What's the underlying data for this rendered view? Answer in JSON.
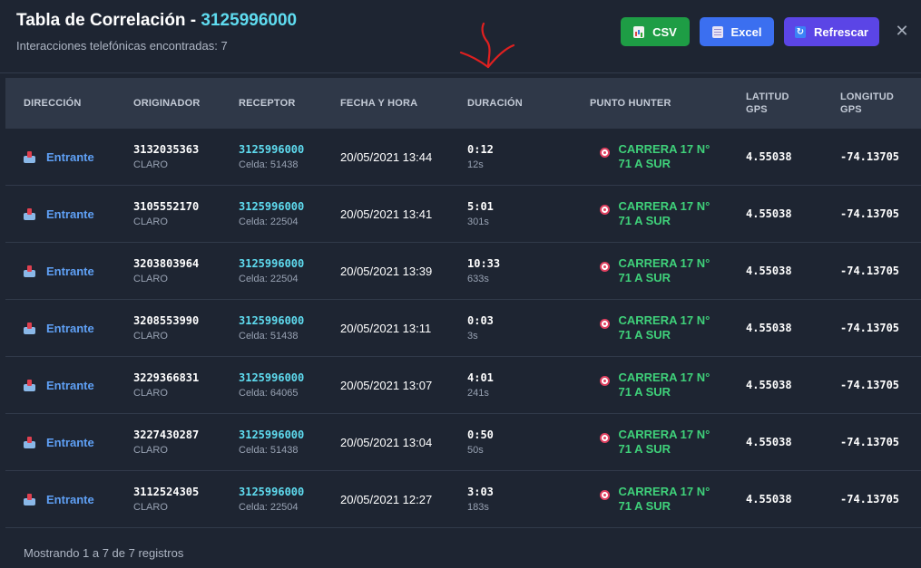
{
  "header": {
    "title": "Tabla de Correlación - ",
    "phone": "3125996000",
    "subtitle": "Interacciones telefónicas encontradas: 7",
    "buttons": {
      "csv": "CSV",
      "excel": "Excel",
      "refresh": "Refrescar"
    },
    "close": "✕"
  },
  "table": {
    "columns": [
      "DIRECCIÓN",
      "ORIGINADOR",
      "RECEPTOR",
      "FECHA Y HORA",
      "DURACIÓN",
      "PUNTO HUNTER",
      "LATITUD GPS",
      "LONGITUD GPS"
    ],
    "rows": [
      {
        "direction": "Entrante",
        "originator": "3132035363",
        "originator_carrier": "CLARO",
        "receiver": "3125996000",
        "receiver_cell": "Celda: 51438",
        "datetime": "20/05/2021 13:44",
        "duration": "0:12",
        "duration_seconds": "12s",
        "hunter": "CARRERA 17 N° 71 A SUR",
        "lat": "4.55038",
        "lon": "-74.13705"
      },
      {
        "direction": "Entrante",
        "originator": "3105552170",
        "originator_carrier": "CLARO",
        "receiver": "3125996000",
        "receiver_cell": "Celda: 22504",
        "datetime": "20/05/2021 13:41",
        "duration": "5:01",
        "duration_seconds": "301s",
        "hunter": "CARRERA 17 N° 71 A SUR",
        "lat": "4.55038",
        "lon": "-74.13705"
      },
      {
        "direction": "Entrante",
        "originator": "3203803964",
        "originator_carrier": "CLARO",
        "receiver": "3125996000",
        "receiver_cell": "Celda: 22504",
        "datetime": "20/05/2021 13:39",
        "duration": "10:33",
        "duration_seconds": "633s",
        "hunter": "CARRERA 17 N° 71 A SUR",
        "lat": "4.55038",
        "lon": "-74.13705"
      },
      {
        "direction": "Entrante",
        "originator": "3208553990",
        "originator_carrier": "CLARO",
        "receiver": "3125996000",
        "receiver_cell": "Celda: 51438",
        "datetime": "20/05/2021 13:11",
        "duration": "0:03",
        "duration_seconds": "3s",
        "hunter": "CARRERA 17 N° 71 A SUR",
        "lat": "4.55038",
        "lon": "-74.13705"
      },
      {
        "direction": "Entrante",
        "originator": "3229366831",
        "originator_carrier": "CLARO",
        "receiver": "3125996000",
        "receiver_cell": "Celda: 64065",
        "datetime": "20/05/2021 13:07",
        "duration": "4:01",
        "duration_seconds": "241s",
        "hunter": "CARRERA 17 N° 71 A SUR",
        "lat": "4.55038",
        "lon": "-74.13705"
      },
      {
        "direction": "Entrante",
        "originator": "3227430287",
        "originator_carrier": "CLARO",
        "receiver": "3125996000",
        "receiver_cell": "Celda: 51438",
        "datetime": "20/05/2021 13:04",
        "duration": "0:50",
        "duration_seconds": "50s",
        "hunter": "CARRERA 17 N° 71 A SUR",
        "lat": "4.55038",
        "lon": "-74.13705"
      },
      {
        "direction": "Entrante",
        "originator": "3112524305",
        "originator_carrier": "CLARO",
        "receiver": "3125996000",
        "receiver_cell": "Celda: 22504",
        "datetime": "20/05/2021 12:27",
        "duration": "3:03",
        "duration_seconds": "183s",
        "hunter": "CARRERA 17 N° 71 A SUR",
        "lat": "4.55038",
        "lon": "-74.13705"
      }
    ]
  },
  "footer": "Mostrando 1 a 7 de 7 registros",
  "colors": {
    "background": "#1e2532",
    "header_row": "#2f3848",
    "accent_cyan": "#5fdcf0",
    "direction_blue": "#5fa0f5",
    "hunter_green": "#3fd17a",
    "csv_button": "#1e9d45",
    "excel_button": "#3b6ff0",
    "refresh_button": "#5b45e6",
    "annotation_red": "#e02020"
  },
  "icons": {
    "csv": "bar-chart-icon",
    "excel": "document-icon",
    "refresh": "refresh-icon",
    "close": "close-icon",
    "direction": "inbox-icon",
    "hunter": "target-icon",
    "annotation": "red-arrow-annotation"
  }
}
